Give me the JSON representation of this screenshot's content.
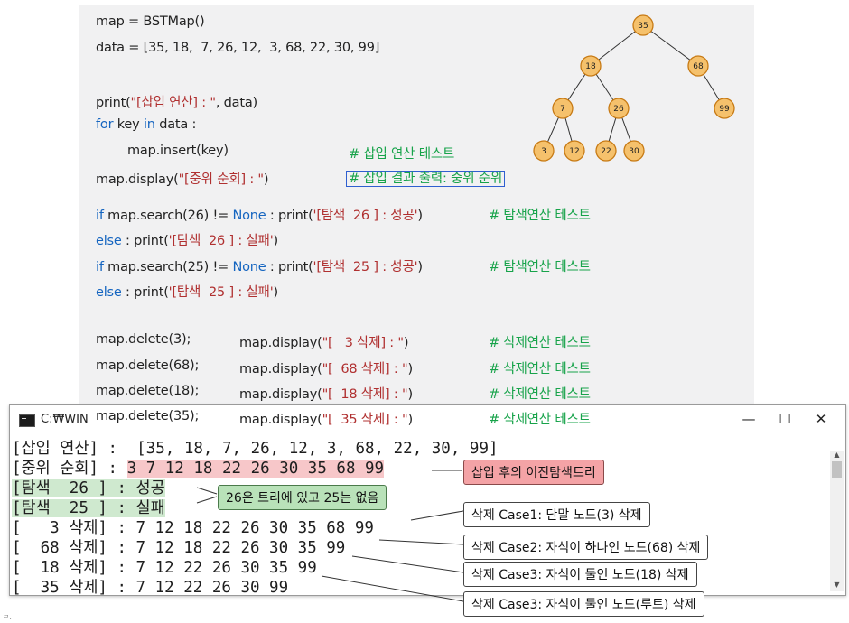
{
  "code": {
    "line1": "map = BSTMap()",
    "line2": "data = [35, 18,  7, 26, 12,  3, 68, 22, 30, 99]",
    "line3a": "print(",
    "line3b": "\"[삽입 연산] : \"",
    "line3c": ", data)",
    "line4a": "for",
    "line4b": " key ",
    "line4c": "in",
    "line4d": " data :",
    "line5": "map.insert(key)",
    "line5_comment": "# 삽입 연산 테스트",
    "line6a": "map.display(",
    "line6b": "\"[중위 순회] : \"",
    "line6c": ")",
    "line6_comment": "# 삽입 결과 출력: 중위 순위",
    "line7a": "if",
    "line7b": " map.search(26) != ",
    "line7c": "None",
    "line7d": " : print(",
    "line7e": "'[탐색  26 ] : 성공'",
    "line7f": ")",
    "line7_comment": "# 탐색연산 테스트",
    "line8a": "else",
    "line8b": " : print(",
    "line8c": "'[탐색  26 ] : 실패'",
    "line8d": ")",
    "line9a": "if",
    "line9b": " map.search(25) != ",
    "line9c": "None",
    "line9d": " : print(",
    "line9e": "'[탐색  25 ] : 성공'",
    "line9f": ")",
    "line9_comment": "# 탐색연산 테스트",
    "line10a": "else",
    "line10b": " : print(",
    "line10c": "'[탐색  25 ] : 실패'",
    "line10d": ")",
    "deletes": [
      {
        "call": "map.delete(3);",
        "disp_a": "map.display(",
        "disp_b": "\"[   3 삭제] : \"",
        "disp_c": ")",
        "comment": "# 삭제연산 테스트"
      },
      {
        "call": "map.delete(68);",
        "disp_a": "map.display(",
        "disp_b": "\"[  68 삭제] : \"",
        "disp_c": ")",
        "comment": "# 삭제연산 테스트"
      },
      {
        "call": "map.delete(18);",
        "disp_a": "map.display(",
        "disp_b": "\"[  18 삭제] : \"",
        "disp_c": ")",
        "comment": "# 삭제연산 테스트"
      },
      {
        "call": "map.delete(35);",
        "disp_a": "map.display(",
        "disp_b": "\"[  35 삭제] : \"",
        "disp_c": ")",
        "comment": "# 삭제연산 테스트"
      }
    ]
  },
  "tree": {
    "nodes": [
      "35",
      "18",
      "68",
      "7",
      "26",
      "99",
      "3",
      "12",
      "22",
      "30"
    ]
  },
  "console": {
    "title": "C:₩WIN",
    "minimize": "—",
    "maximize": "☐",
    "close": "✕",
    "lines": {
      "insert": "[삽입 연산] :  [35, 18, 7, 26, 12, 3, 68, 22, 30, 99]",
      "inorder_label": "[중위 순회] : ",
      "inorder_values": "3 7 12 18 22 26 30 35 68 99",
      "search26": "[탐색  26 ] : 성공",
      "search25": "[탐색  25 ] : 실패",
      "del3": "[   3 삭제] : 7 12 18 22 26 30 35 68 99",
      "del68": "[  68 삭제] : 7 12 18 22 26 30 35 99",
      "del18": "[  18 삭제] : 7 12 22 26 30 35 99",
      "del35": "[  35 삭제] : 7 12 22 26 30 99"
    }
  },
  "callouts": {
    "bst": "삽입 후의 이진탐색트리",
    "search": "26은 트리에 있고 25는 없음",
    "case1": "삭제 Case1: 단말 노드(3) 삭제",
    "case2": "삭제 Case2: 자식이 하나인 노드(68) 삭제",
    "case3a": "삭제 Case3: 자식이 둘인 노드(18) 삭제",
    "case3b": "삭제 Case3: 자식이 둘인 노드(루트) 삭제"
  },
  "colors": {
    "node_fill": "#f5c16c",
    "node_stroke": "#c77a14",
    "keyword": "#1565c0",
    "string": "#b03030",
    "comment": "#17a34a",
    "pink_callout": "#f4a3a6",
    "green_callout": "#b9e2b9"
  },
  "footnote": "ㄹ."
}
